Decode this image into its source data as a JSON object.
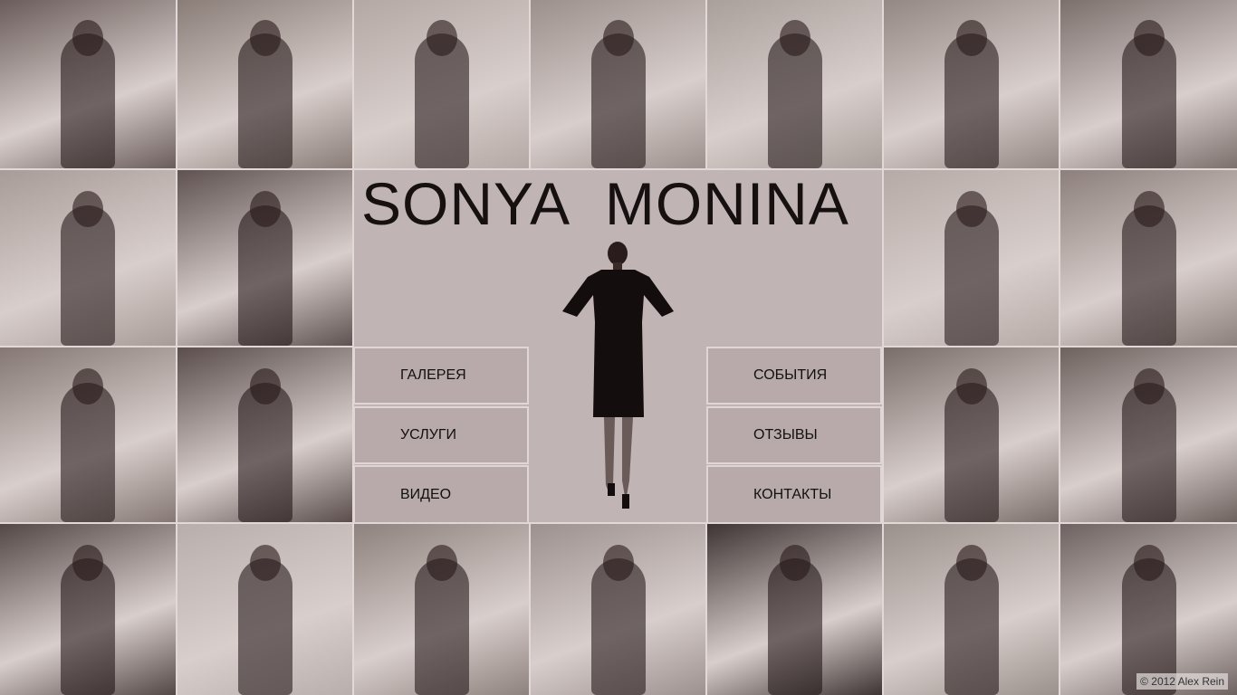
{
  "site": {
    "title": "SONYA MONINA"
  },
  "menu_left": [
    {
      "label": "ГАЛЕРЕЯ"
    },
    {
      "label": "УСЛУГИ"
    },
    {
      "label": "ВИДЕО"
    }
  ],
  "menu_right": [
    {
      "label": "СОБЫТИЯ"
    },
    {
      "label": "ОТЗЫВЫ"
    },
    {
      "label": "КОНТАКТЫ"
    }
  ],
  "footer": {
    "copyright": "© 2012 Alex Rein"
  },
  "colors": {
    "center_bg": "#c0b4b4",
    "button_bg": "#b8aaaa",
    "border": "#e0d6d6",
    "text": "#111111"
  },
  "tile_tones": [
    "#6a5c5a",
    "#8a7d78",
    "#b3a8a4",
    "#9b908c",
    "#a9a09c",
    "#948884",
    "#7c706d",
    "#a89c98",
    "#5f5250",
    "#b5aaa6",
    "#8d807c",
    "#857874",
    "#5a4d4b",
    "#7a6e6a",
    "#6e625f",
    "#544846",
    "#b8aeab",
    "#8e827e",
    "#9c918e",
    "#3e3433",
    "#9a908c",
    "#6d625f"
  ]
}
